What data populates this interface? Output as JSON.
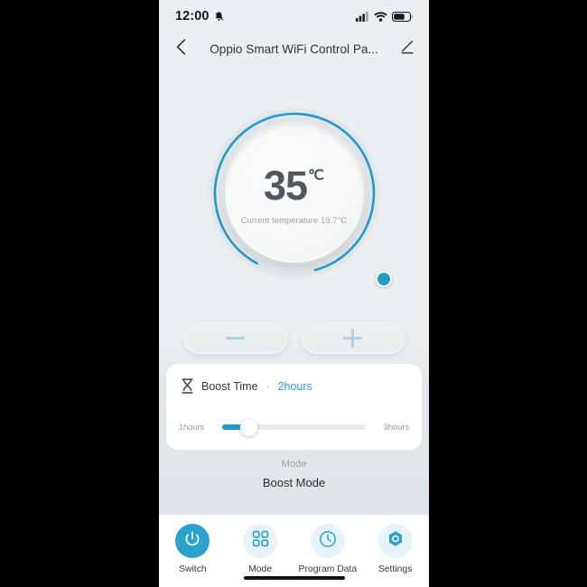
{
  "status_bar": {
    "time": "12:00",
    "icons": [
      "bell-mute-icon",
      "signal-icon",
      "wifi-icon",
      "battery-icon"
    ],
    "battery_level": 62
  },
  "header": {
    "back_icon": "chevron-left-icon",
    "title": "Oppio Smart WiFi Control Pa...",
    "edit_icon": "pencil-icon"
  },
  "dial": {
    "target_temp": "35",
    "unit": "℃",
    "current_temp_text": "Current temperature 19.7°C",
    "arc_color": "#1f9bc7",
    "arc_percent": 88,
    "knob_label": "dial-knob"
  },
  "stepper": {
    "minus_label": "−",
    "plus_label": "+",
    "glyph_color": "#aed4e4"
  },
  "boost": {
    "icon": "hourglass-icon",
    "label": "Boost Time",
    "separator": "·",
    "value": "2hours",
    "value_color": "#2aa3d0",
    "slider": {
      "min_label": "1hours",
      "max_label": "9hours",
      "fill_percent": 18,
      "fill_color": "#1f9bc7",
      "track_color": "#e7eaec"
    }
  },
  "mode": {
    "label": "Mode",
    "value": "Boost Mode"
  },
  "tabbar": {
    "items": [
      {
        "label": "Switch",
        "icon": "power-icon",
        "active": true
      },
      {
        "label": "Mode",
        "icon": "grid-icon",
        "active": false
      },
      {
        "label": "Program Data",
        "icon": "clock-icon",
        "active": false
      },
      {
        "label": "Settings",
        "icon": "gear-hexagon-icon",
        "active": false
      }
    ],
    "accent_color": "#2ba2cc",
    "inactive_bg": "#e6f4f9"
  },
  "theme": {
    "background": "#eceff1",
    "card_background": "#ffffff",
    "accent": "#1f9bc7",
    "text_primary": "#272c30",
    "text_muted": "#9aa4aa"
  }
}
